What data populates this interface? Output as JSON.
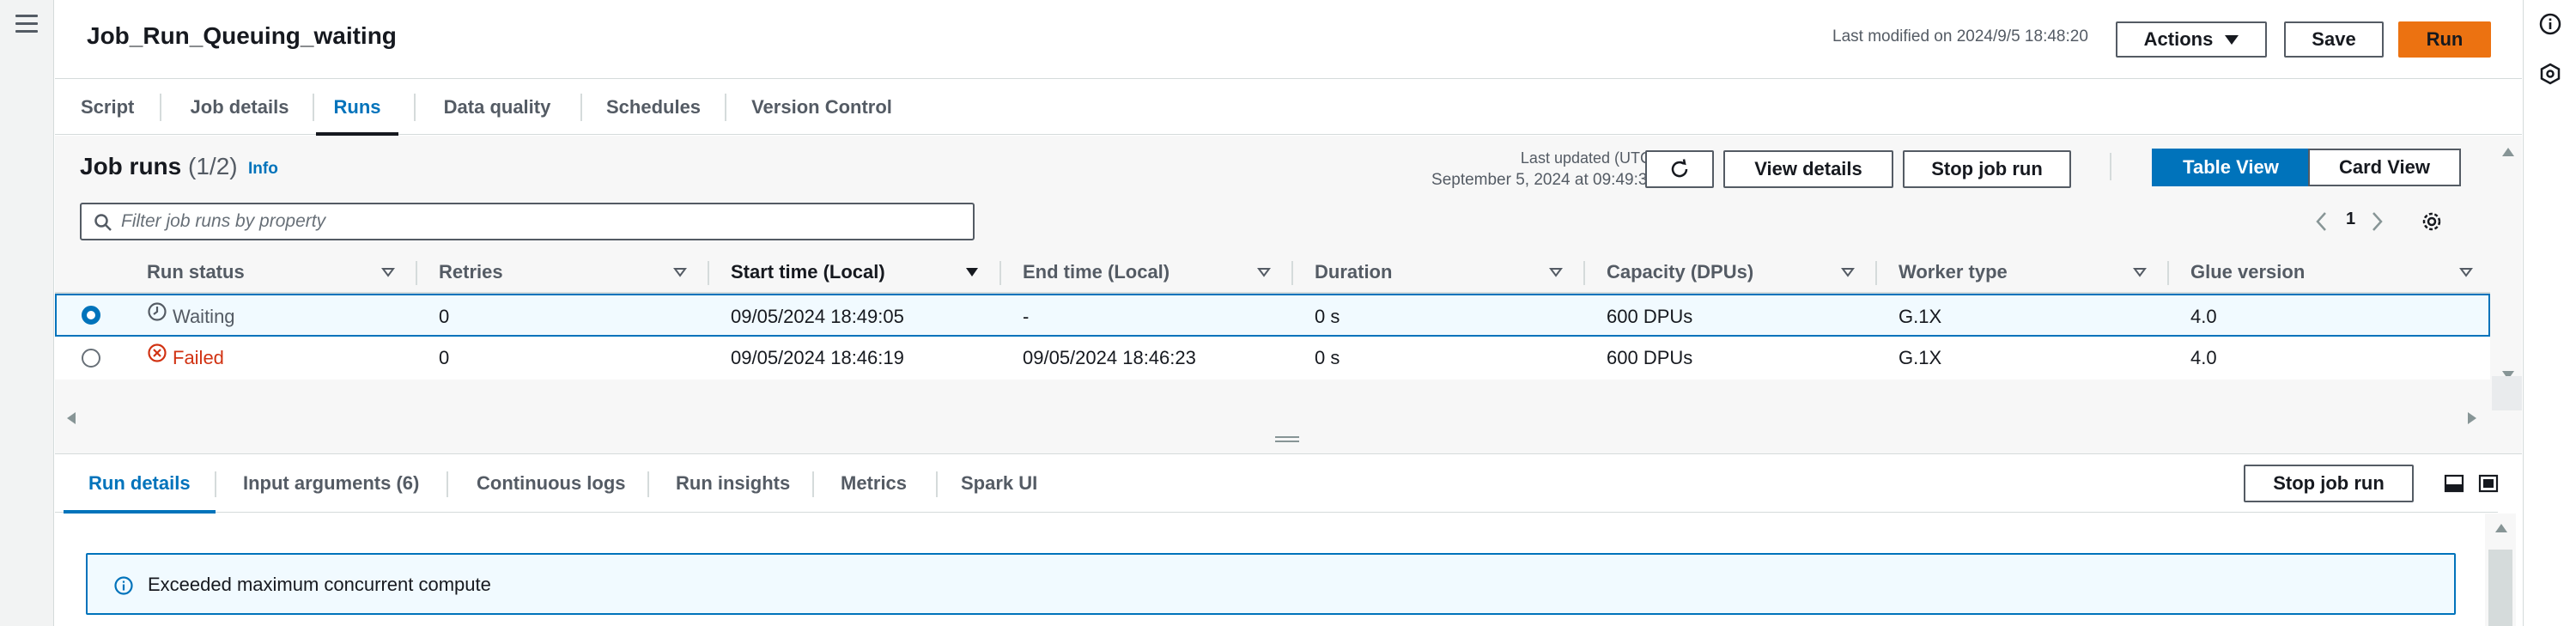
{
  "header": {
    "title": "Job_Run_Queuing_waiting",
    "last_modified": "Last modified on 2024/9/5 18:48:20",
    "actions_label": "Actions",
    "save_label": "Save",
    "run_label": "Run"
  },
  "tabs": [
    {
      "label": "Script"
    },
    {
      "label": "Job details"
    },
    {
      "label": "Runs",
      "active": true
    },
    {
      "label": "Data quality"
    },
    {
      "label": "Schedules"
    },
    {
      "label": "Version Control"
    }
  ],
  "runs": {
    "title": "Job runs",
    "count": "(1/2)",
    "info_label": "Info",
    "last_updated_label": "Last updated (UTC)",
    "last_updated_value": "September 5, 2024 at 09:49:33",
    "view_details_label": "View details",
    "stop_job_run_label": "Stop job run",
    "table_view_label": "Table View",
    "card_view_label": "Card View",
    "filter_placeholder": "Filter job runs by property",
    "page_number": "1",
    "columns": [
      "Run status",
      "Retries",
      "Start time (Local)",
      "End time (Local)",
      "Duration",
      "Capacity (DPUs)",
      "Worker type",
      "Glue version"
    ],
    "sorted_column": "Start time (Local)",
    "rows": [
      {
        "selected": true,
        "status": "Waiting",
        "retries": "0",
        "start_time": "09/05/2024 18:49:05",
        "end_time": "-",
        "duration": "0 s",
        "capacity": "600 DPUs",
        "worker_type": "G.1X",
        "glue_version": "4.0"
      },
      {
        "selected": false,
        "status": "Failed",
        "retries": "0",
        "start_time": "09/05/2024 18:46:19",
        "end_time": "09/05/2024 18:46:23",
        "duration": "0 s",
        "capacity": "600 DPUs",
        "worker_type": "G.1X",
        "glue_version": "4.0"
      }
    ]
  },
  "bottom": {
    "tabs": [
      {
        "label": "Run details",
        "active": true
      },
      {
        "label": "Input arguments (6)"
      },
      {
        "label": "Continuous logs"
      },
      {
        "label": "Run insights"
      },
      {
        "label": "Metrics"
      },
      {
        "label": "Spark UI"
      }
    ],
    "stop_job_run_label": "Stop job run",
    "alert_message": "Exceeded maximum concurrent compute"
  },
  "colors": {
    "accent": "#0073bb",
    "run_button": "#ec7211",
    "failed": "#d13212"
  },
  "icons": [
    "hamburger-menu-icon",
    "info-circle-icon",
    "hexagon-icon",
    "refresh-icon",
    "search-icon",
    "chevron-left-icon",
    "chevron-right-icon",
    "settings-gear-icon",
    "clock-icon",
    "error-x-icon",
    "panel-bottom-icon",
    "panel-full-icon"
  ]
}
